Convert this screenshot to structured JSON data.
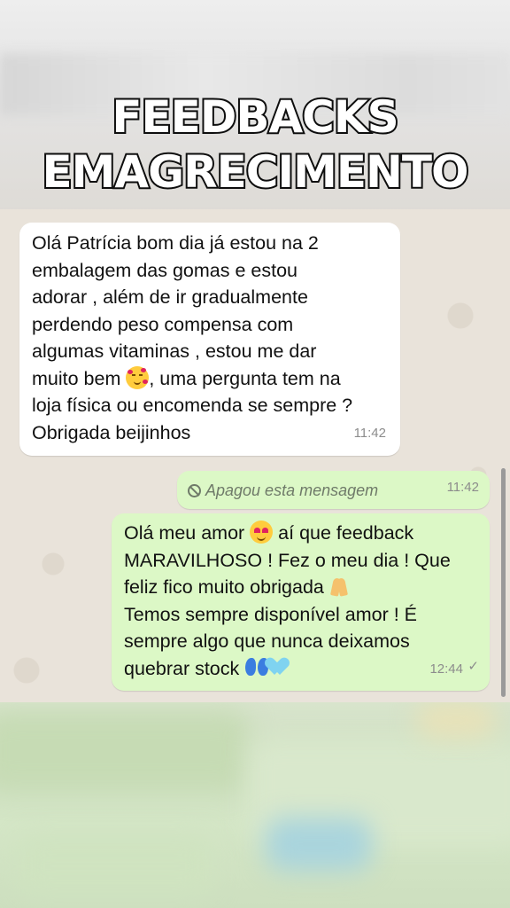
{
  "header": {
    "line1": "FEEDBACKS",
    "line2": "EMAGRECIMENTO"
  },
  "messages": {
    "incoming": {
      "text_part1": "Olá Patrícia bom dia já estou na 2\nembalagem das gomas e estou\nadorar , além de ir gradualmente\nperdendo peso compensa com\nalgumas vitaminas , estou me dar\nmuito bem ",
      "text_part2": ", uma pergunta tem na\nloja física ou encomenda se sempre ?\nObrigada beijinhos",
      "time": "11:42"
    },
    "deleted": {
      "text": "Apagou esta mensagem",
      "time": "11:42"
    },
    "outgoing": {
      "part1": "Olá meu amor ",
      "part2": " aí que feedback\nMARAVILHOSO ! Fez o meu dia ! Que\nfeliz fico muito obrigada ",
      "part3": "\nTemos sempre disponível amor ! É\nsempre algo que nunca deixamos\nquebrar stock ",
      "time": "12:44"
    }
  },
  "colors": {
    "incoming_bubble": "#ffffff",
    "outgoing_bubble": "#dcf8c6",
    "chat_background": "#e9e3da"
  }
}
